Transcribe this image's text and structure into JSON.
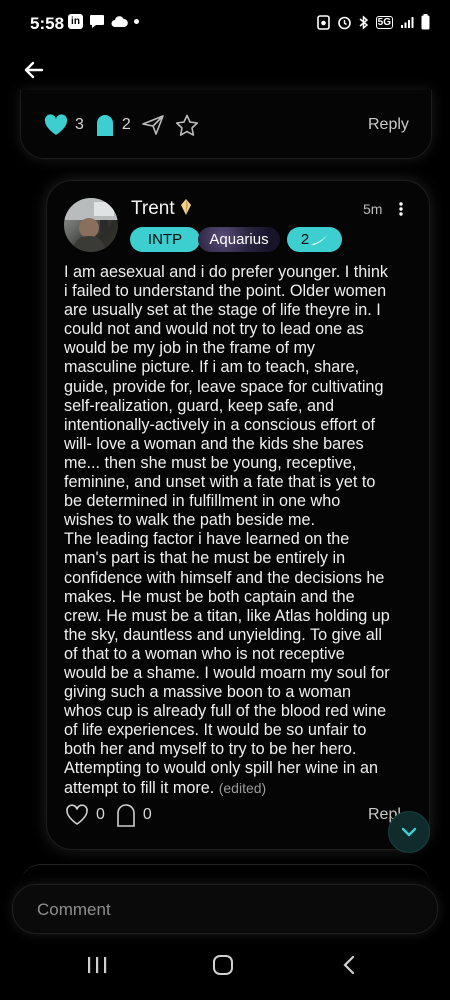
{
  "status_bar": {
    "time": "5:58",
    "left_icons": [
      "linkedin-icon",
      "chat-icon",
      "cloud-icon",
      "dot-icon"
    ],
    "right_icons": [
      "alarm-icon",
      "clock-icon",
      "bluetooth-icon",
      "5g-icon",
      "signal-icon",
      "battery-icon"
    ],
    "network_label": "5G"
  },
  "prev_comment": {
    "like_count": "3",
    "ghost_count": "2",
    "reply_label": "Reply"
  },
  "comment": {
    "username": "Trent",
    "time_ago": "5m",
    "mbti": "INTP",
    "zodiac": "Aquarius",
    "badge_count": "2",
    "body": "I am aesexual and i do prefer younger. I think\ni failed to understand the point. Older women\nare usually set at the stage of life theyre in. I\ncould not and would not try to lead one as\nwould be my job in the frame of my\nmasculine picture. If i am to teach, share,\nguide, provide for, leave space for cultivating\nself-realization, guard, keep safe, and\nintentionally-actively in a conscious effort of\nwill- love a woman and the kids she bares\nme... then she must be young, receptive,\nfeminine, and unset with a fate that is yet to\nbe determined in fulfillment in one who\nwishes to walk the path beside me.\nThe leading factor i have learned on the\nman's part is that he must be entirely in\nconfidence with himself and the decisions he\nmakes. He must be both captain and the\ncrew. He must be a titan, like Atlas holding up\nthe sky, dauntless and unyielding. To give all\nof that to a woman who is not receptive\nwould be a shame. I would moarn my soul for\ngiving such a massive boon to a woman\nwhos cup is already full of the blood red wine\nof life experiences. It would be so unfair to\nboth her and myself to try to be her hero.\nAttempting to would only spill her wine in an\nattempt to fill it more.",
    "edited_label": "(edited)",
    "like_count": "0",
    "ghost_count": "0",
    "reply_label": "Repl"
  },
  "comment_input": {
    "placeholder": "Comment"
  },
  "colors": {
    "accent": "#3dcfcf",
    "background": "#000000"
  }
}
